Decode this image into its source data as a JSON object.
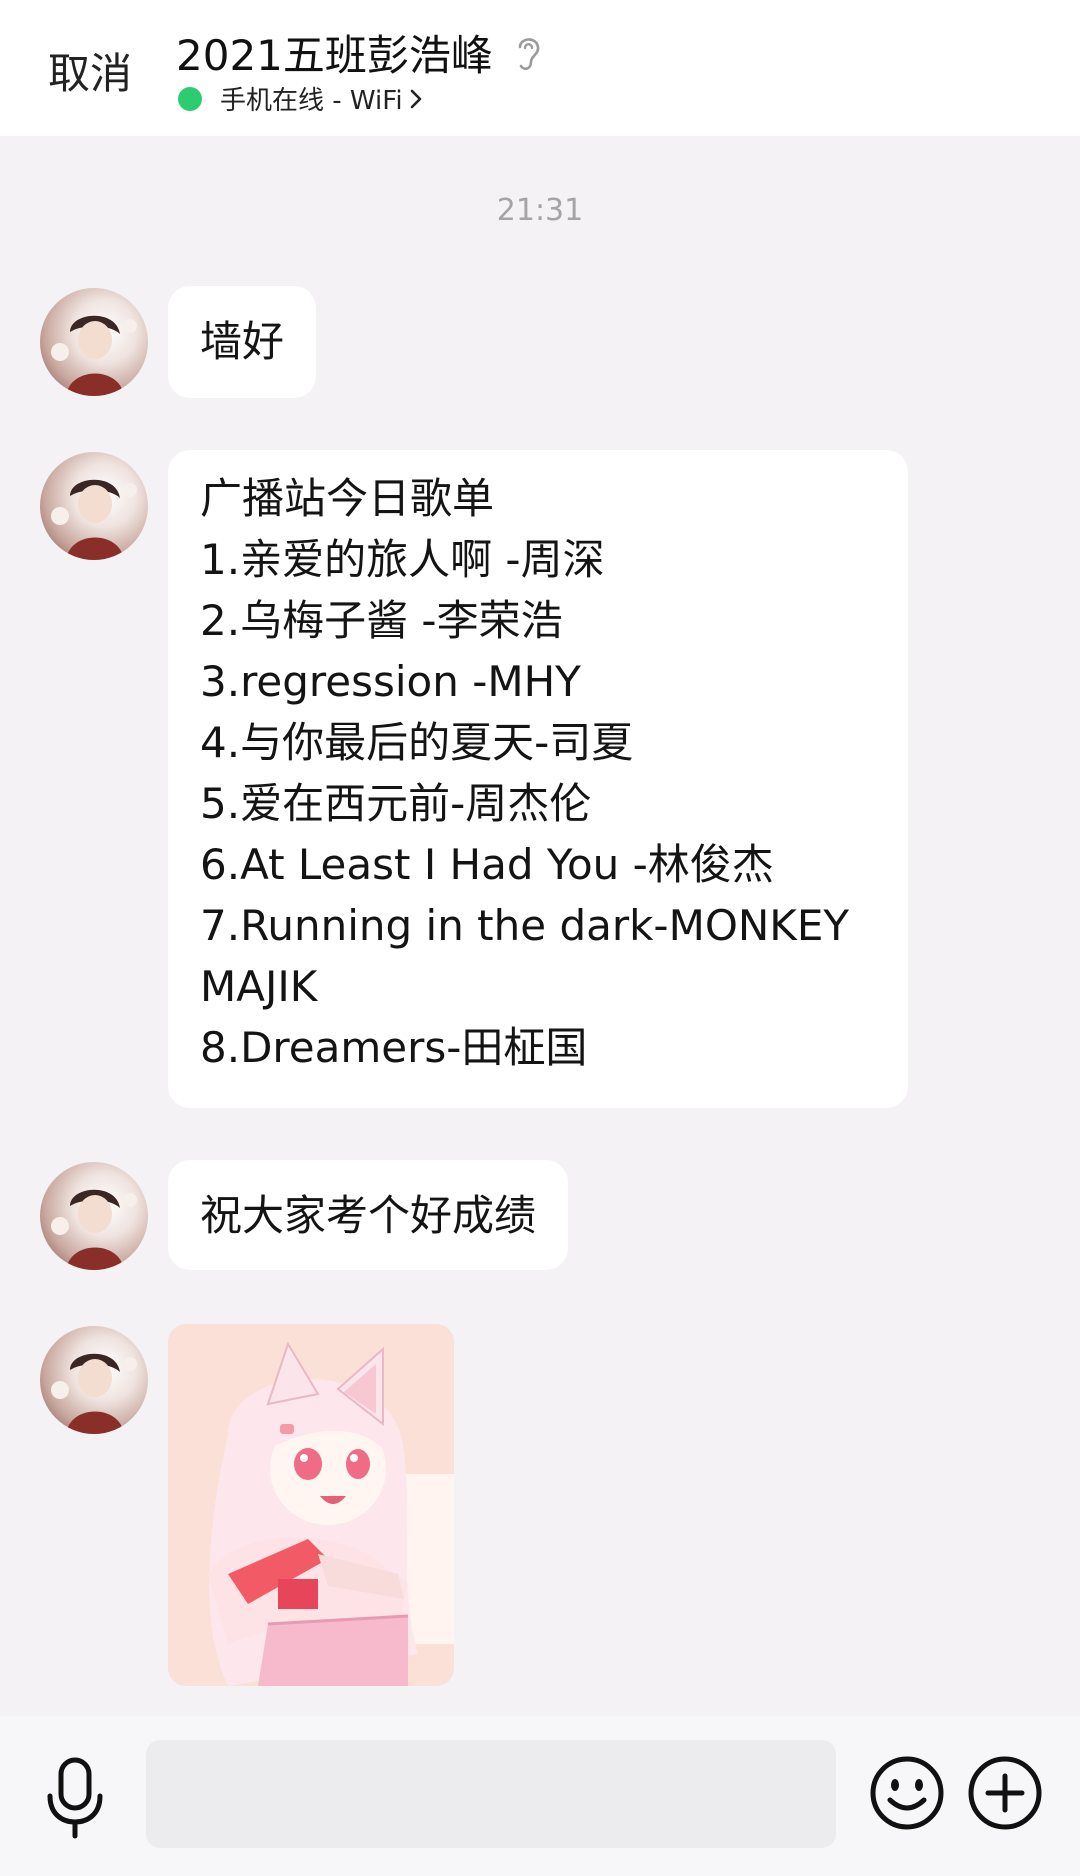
{
  "header": {
    "cancel_label": "取消",
    "title": "2021五班彭浩峰",
    "status_text": "手机在线 - WiFi",
    "status_color": "#2ecc71"
  },
  "chat": {
    "timestamp": "21:31",
    "messages": [
      {
        "type": "text",
        "lines": [
          "墙好"
        ]
      },
      {
        "type": "text",
        "lines": [
          "广播站今日歌单",
          "1.亲爱的旅人啊 -周深",
          "2.乌梅子酱 -李荣浩",
          "3.regression -MHY",
          "4.与你最后的夏天-司夏",
          "5.爱在西元前-周杰伦",
          "6.At Least I Had You -林俊杰",
          "7.Running in the dark-MONKEY",
          "MAJIK",
          "8.Dreamers-田柾国"
        ]
      },
      {
        "type": "text",
        "lines": [
          "祝大家考个好成绩"
        ]
      },
      {
        "type": "image",
        "icon": "anime-cat-girl-sticker"
      }
    ]
  },
  "input_bar": {
    "placeholder": "",
    "mic_icon": "microphone-icon",
    "emoji_icon": "smiley-icon",
    "plus_icon": "plus-icon"
  }
}
